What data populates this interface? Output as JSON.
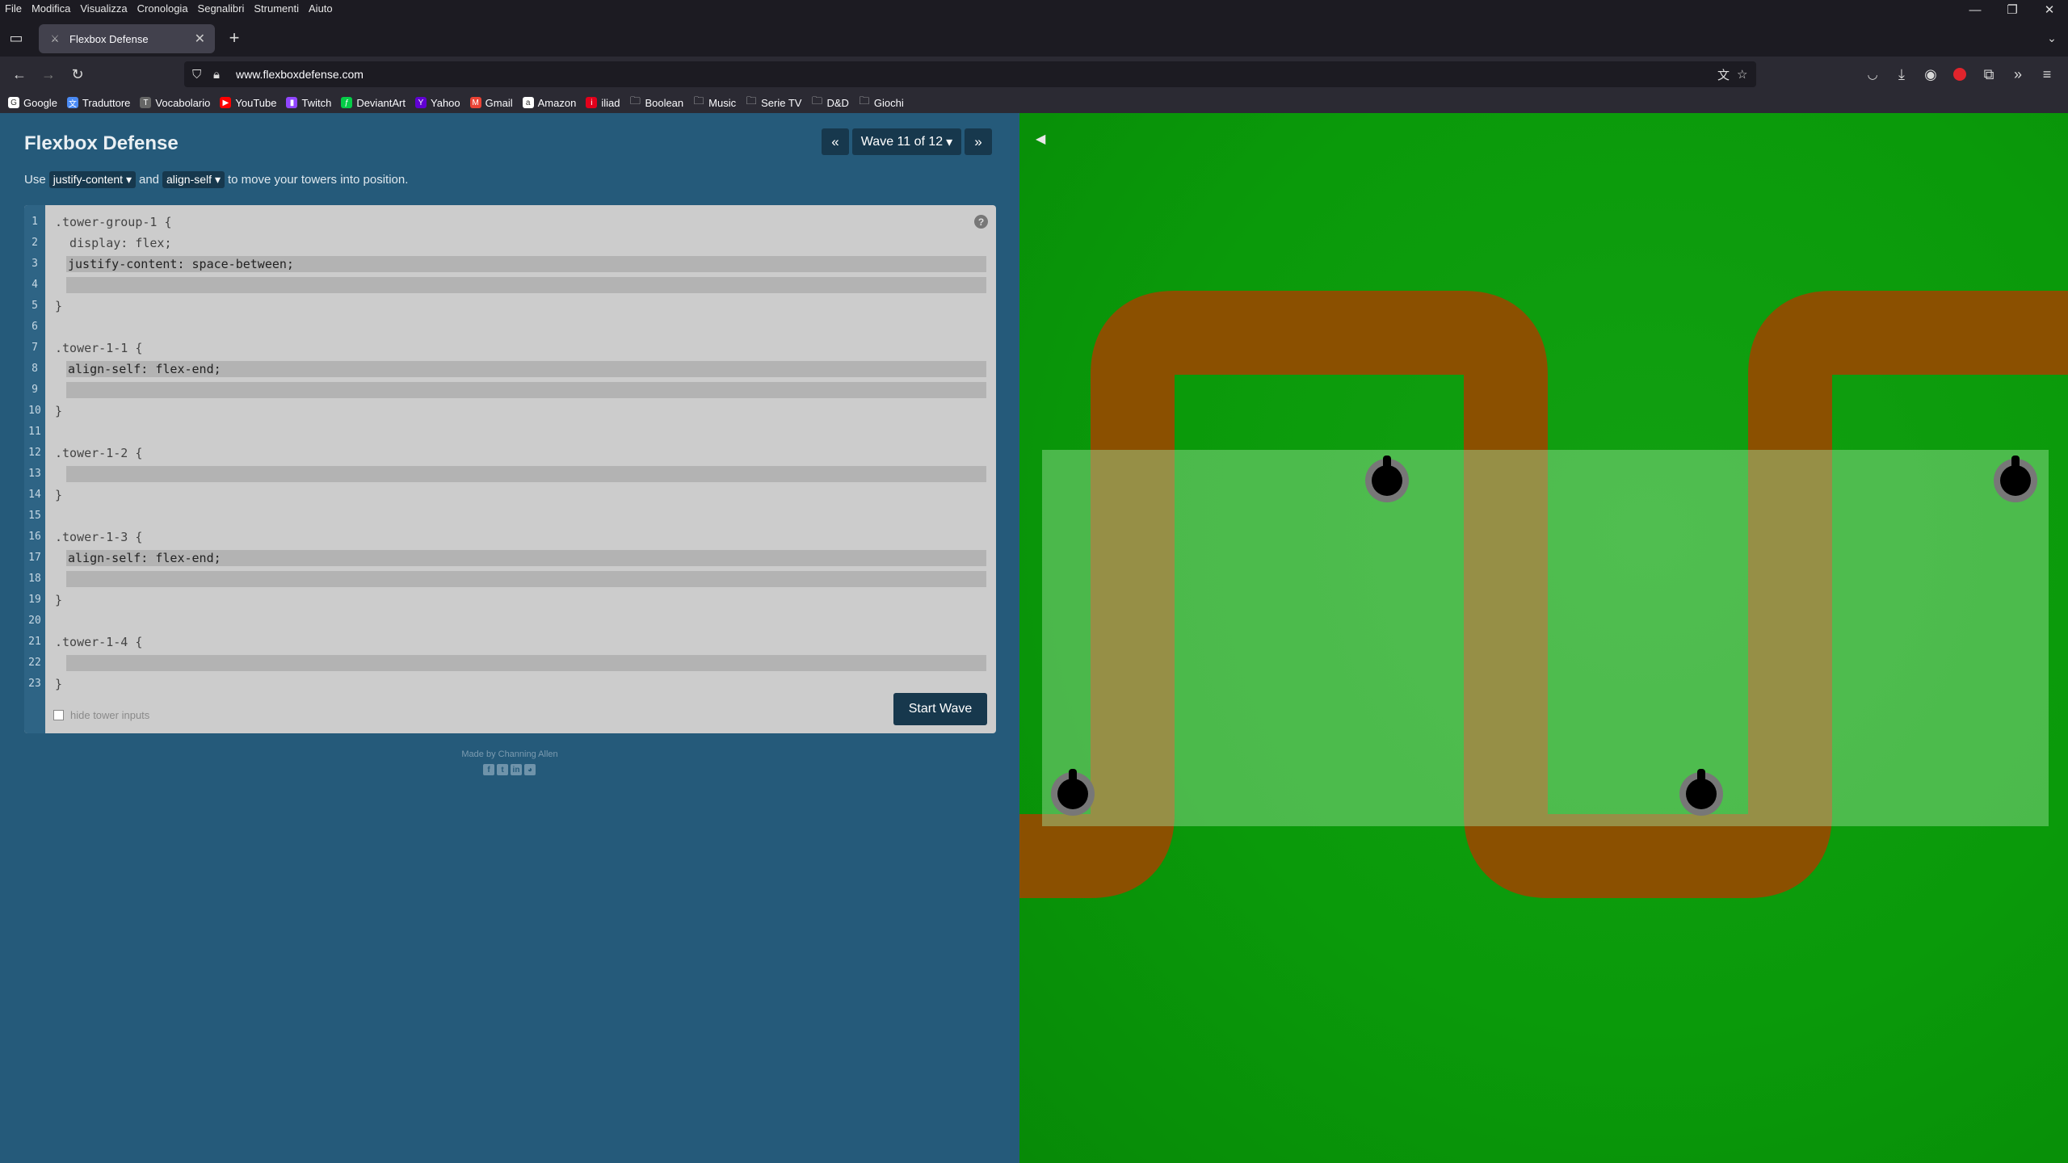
{
  "menubar": {
    "items": [
      "File",
      "Modifica",
      "Visualizza",
      "Cronologia",
      "Segnalibri",
      "Strumenti",
      "Aiuto"
    ]
  },
  "tab": {
    "title": "Flexbox Defense",
    "close": "✕"
  },
  "address": {
    "url": "www.flexboxdefense.com"
  },
  "bookmarks": [
    {
      "label": "Google",
      "icon": "google-icon",
      "color": "#ffffff"
    },
    {
      "label": "Traduttore",
      "icon": "translate-icon",
      "color": "#4a8af4"
    },
    {
      "label": "Vocabolario",
      "icon": "vocabolario-icon",
      "color": "#666666"
    },
    {
      "label": "YouTube",
      "icon": "youtube-icon",
      "color": "#ff0000"
    },
    {
      "label": "Twitch",
      "icon": "twitch-icon",
      "color": "#9146ff"
    },
    {
      "label": "DeviantArt",
      "icon": "deviantart-icon",
      "color": "#05cc47"
    },
    {
      "label": "Yahoo",
      "icon": "yahoo-icon",
      "color": "#6001d2"
    },
    {
      "label": "Gmail",
      "icon": "gmail-icon",
      "color": "#ea4335"
    },
    {
      "label": "Amazon",
      "icon": "amazon-icon",
      "color": "#ffffff"
    },
    {
      "label": "iliad",
      "icon": "iliad-icon",
      "color": "#e3001b"
    },
    {
      "label": "Boolean",
      "icon": "folder-icon",
      "color": ""
    },
    {
      "label": "Music",
      "icon": "folder-icon",
      "color": ""
    },
    {
      "label": "Serie TV",
      "icon": "folder-icon",
      "color": ""
    },
    {
      "label": "D&D",
      "icon": "folder-icon",
      "color": ""
    },
    {
      "label": "Giochi",
      "icon": "folder-icon",
      "color": ""
    }
  ],
  "game": {
    "title": "Flexbox Defense",
    "wave_label": "Wave 11 of 12",
    "wave_prev": "«",
    "wave_next": "»",
    "wave_dropdown": "▾",
    "instructions": {
      "use": "Use",
      "kw1": "justify-content",
      "and": "and",
      "kw2": "align-self",
      "rest": "to move your towers into position.",
      "arrow": "▾"
    },
    "editor": {
      "line_numbers": [
        "1",
        "2",
        "3",
        "4",
        "5",
        "6",
        "7",
        "8",
        "9",
        "10",
        "11",
        "12",
        "13",
        "14",
        "15",
        "16",
        "17",
        "18",
        "19",
        "20",
        "21",
        "22",
        "23"
      ],
      "line1": ".tower-group-1 {",
      "line2": "  display: flex;",
      "input3": "justify-content: space-between;",
      "input4": "",
      "line5": "}",
      "line7": ".tower-1-1 {",
      "input8": "align-self: flex-end;",
      "input9": "",
      "line10": "}",
      "line12": ".tower-1-2 {",
      "input13": "",
      "line14": "}",
      "line16": ".tower-1-3 {",
      "input17": "align-self: flex-end;",
      "input18": "",
      "line19": "}",
      "line21": ".tower-1-4 {",
      "input22": "",
      "line23": "}",
      "help": "?",
      "start_wave": "Start Wave",
      "hide_inputs": "hide tower inputs"
    },
    "credits": "Made by Channing Allen",
    "social_icons": [
      "facebook-icon",
      "twitter-icon",
      "linkedin-icon",
      "github-icon"
    ],
    "colors": {
      "panel": "#255a7a",
      "grass": "#0a9a0a",
      "path": "#8b5000",
      "tower_zone": "rgba(150,220,150,0.45)"
    }
  }
}
